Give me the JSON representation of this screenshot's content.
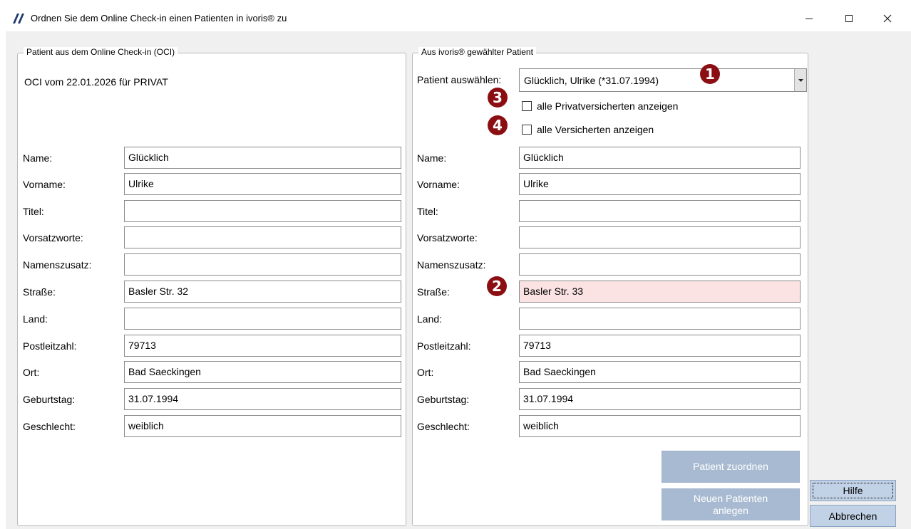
{
  "window": {
    "title": "Ordnen Sie dem Online Check-in einen Patienten in ivoris® zu"
  },
  "left": {
    "legend": "Patient aus dem Online Check-in (OCI)",
    "oci_header": "OCI vom 22.01.2026 für PRIVAT",
    "fields": [
      {
        "label": "Name:",
        "value": "Glücklich"
      },
      {
        "label": "Vorname:",
        "value": "Ulrike"
      },
      {
        "label": "Titel:",
        "value": ""
      },
      {
        "label": "Vorsatzworte:",
        "value": ""
      },
      {
        "label": "Namenszusatz:",
        "value": ""
      },
      {
        "label": "Straße:",
        "value": "Basler Str. 32"
      },
      {
        "label": "Land:",
        "value": ""
      },
      {
        "label": "Postleitzahl:",
        "value": "79713"
      },
      {
        "label": "Ort:",
        "value": "Bad Saeckingen"
      },
      {
        "label": "Geburtstag:",
        "value": "31.07.1994"
      },
      {
        "label": "Geschlecht:",
        "value": "weiblich"
      }
    ]
  },
  "right": {
    "legend": "Aus ivoris® gewählter Patient",
    "select_label": "Patient auswählen:",
    "select_value": "Glücklich, Ulrike (*31.07.1994)",
    "checkbox_private": "alle Privatversicherten anzeigen",
    "checkbox_all": "alle Versicherten anzeigen",
    "fields": [
      {
        "label": "Name:",
        "value": "Glücklich"
      },
      {
        "label": "Vorname:",
        "value": "Ulrike"
      },
      {
        "label": "Titel:",
        "value": ""
      },
      {
        "label": "Vorsatzworte:",
        "value": ""
      },
      {
        "label": "Namenszusatz:",
        "value": ""
      },
      {
        "label": "Straße:",
        "value": "Basler Str. 33"
      },
      {
        "label": "Land:",
        "value": ""
      },
      {
        "label": "Postleitzahl:",
        "value": "79713"
      },
      {
        "label": "Ort:",
        "value": "Bad Saeckingen"
      },
      {
        "label": "Geburtstag:",
        "value": "31.07.1994"
      },
      {
        "label": "Geschlecht:",
        "value": "weiblich"
      }
    ],
    "btn_assign": "Patient zuordnen",
    "btn_new_line1": "Neuen Patienten",
    "btn_new_line2": "anlegen"
  },
  "side": {
    "help": "Hilfe",
    "cancel": "Abbrechen"
  },
  "badges": [
    "1",
    "2",
    "3",
    "4"
  ],
  "colors": {
    "badge": "#8b0f12",
    "diff_highlight": "#fbe3e3",
    "disabled_button": "#a8bad1"
  }
}
